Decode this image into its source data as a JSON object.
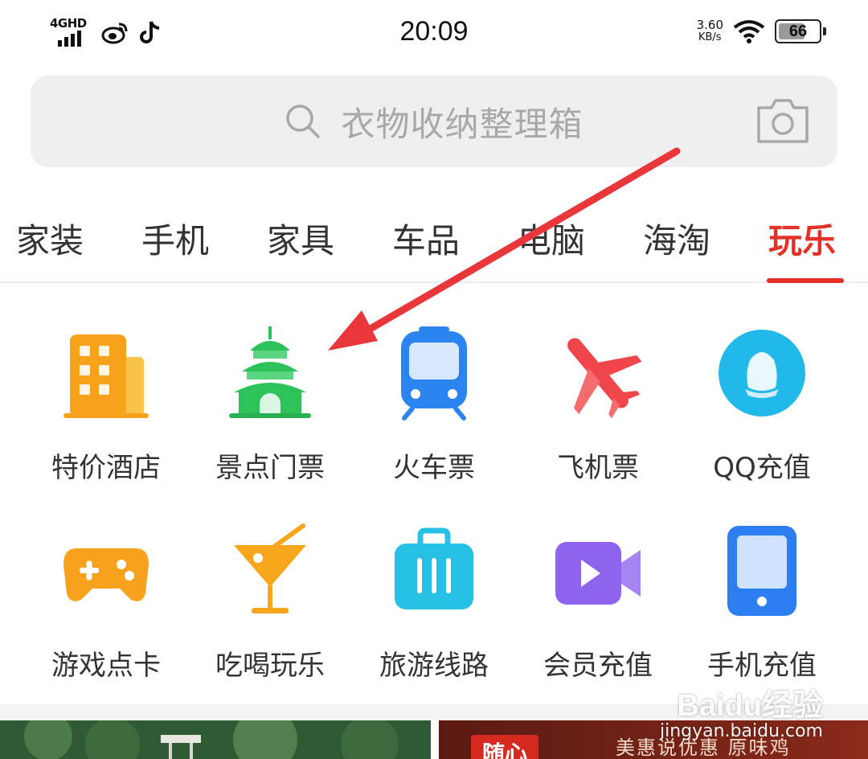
{
  "status_bar": {
    "network": "4GHD",
    "time": "20:09",
    "speed_value": "3.60",
    "speed_unit": "KB/s",
    "battery": "66",
    "battery_level": 0.66
  },
  "search": {
    "placeholder": "衣物收纳整理箱"
  },
  "tabs": [
    {
      "label": "家装",
      "active": false
    },
    {
      "label": "手机",
      "active": false
    },
    {
      "label": "家具",
      "active": false
    },
    {
      "label": "车品",
      "active": false
    },
    {
      "label": "电脑",
      "active": false
    },
    {
      "label": "海淘",
      "active": false
    },
    {
      "label": "玩乐",
      "active": true
    }
  ],
  "grid": [
    {
      "label": "特价酒店",
      "icon": "hotel-building-icon",
      "color": "#f7a21b"
    },
    {
      "label": "景点门票",
      "icon": "temple-icon",
      "color": "#2ec25b"
    },
    {
      "label": "火车票",
      "icon": "train-icon",
      "color": "#2b84f0"
    },
    {
      "label": "飞机票",
      "icon": "airplane-icon",
      "color": "#f0454a"
    },
    {
      "label": "QQ充值",
      "icon": "qq-penguin-icon",
      "color": "#22b9ea"
    },
    {
      "label": "游戏点卡",
      "icon": "gamepad-icon",
      "color": "#f8a11d"
    },
    {
      "label": "吃喝玩乐",
      "icon": "cocktail-icon",
      "color": "#f8a71c"
    },
    {
      "label": "旅游线路",
      "icon": "suitcase-icon",
      "color": "#27c1e6"
    },
    {
      "label": "会员充值",
      "icon": "video-icon",
      "color": "#8e64ee"
    },
    {
      "label": "手机充值",
      "icon": "phone-icon",
      "color": "#2d7ef0"
    }
  ],
  "banners": {
    "right_tag": "随心",
    "right_text": "美惠说优惠   原味鸡"
  },
  "watermark": {
    "logo": "Baidu经验",
    "url": "jingyan.baidu.com"
  },
  "colors": {
    "accent": "#e4322b",
    "annotation_arrow": "#e8363a"
  }
}
